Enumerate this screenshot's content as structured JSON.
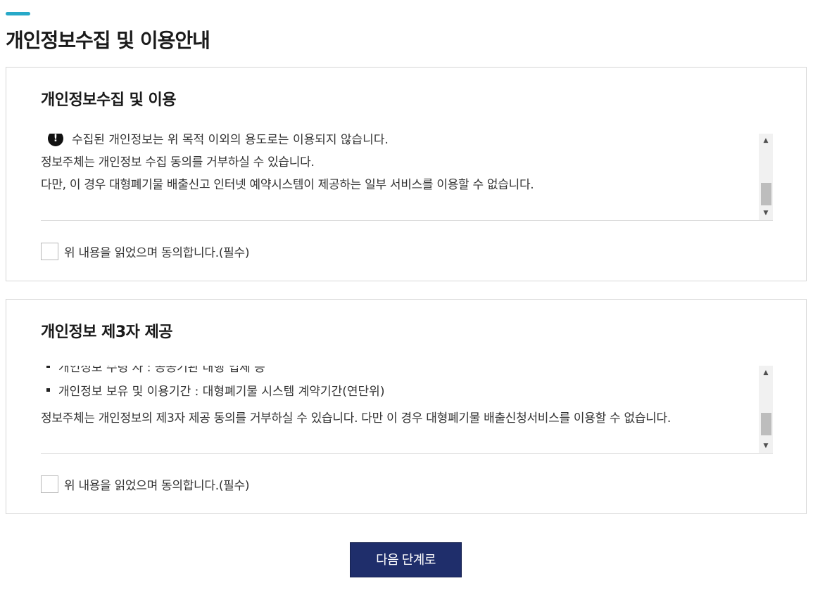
{
  "page": {
    "title": "개인정보수집 및 이용안내"
  },
  "section1": {
    "title": "개인정보수집 및 이용",
    "notice_text": "수집된 개인정보는 위 목적 이외의 용도로는 이용되지 않습니다.",
    "line1": "정보주체는 개인정보 수집 동의를 거부하실 수 있습니다.",
    "line2": "다만, 이 경우 대형폐기물 배출신고 인터넷 예약시스템이 제공하는 일부 서비스를 이용할 수 없습니다.",
    "agree_label": "위 내용을 읽었으며 동의합니다.(필수)"
  },
  "section2": {
    "title": "개인정보 제3자 제공",
    "partial_bullet": "개인정보 수령 자 : 공공기관 대행 업체 등",
    "bullet1": "개인정보 보유 및 이용기간 : 대형폐기물 시스템 계약기간(연단위)",
    "line1": "정보주체는 개인정보의 제3자 제공 동의를 거부하실 수 있습니다. 다만 이 경우 대형폐기물 배출신청서비스를 이용할 수 없습니다.",
    "agree_label": "위 내용을 읽었으며 동의합니다.(필수)"
  },
  "actions": {
    "next_label": "다음 단계로"
  },
  "colors": {
    "accent": "#27a9c8",
    "button_bg": "#1f2e6b"
  },
  "icons": {
    "notice": "exclamation-circle-icon",
    "scroll_up": "arrow-up-icon",
    "scroll_down": "arrow-down-icon"
  }
}
